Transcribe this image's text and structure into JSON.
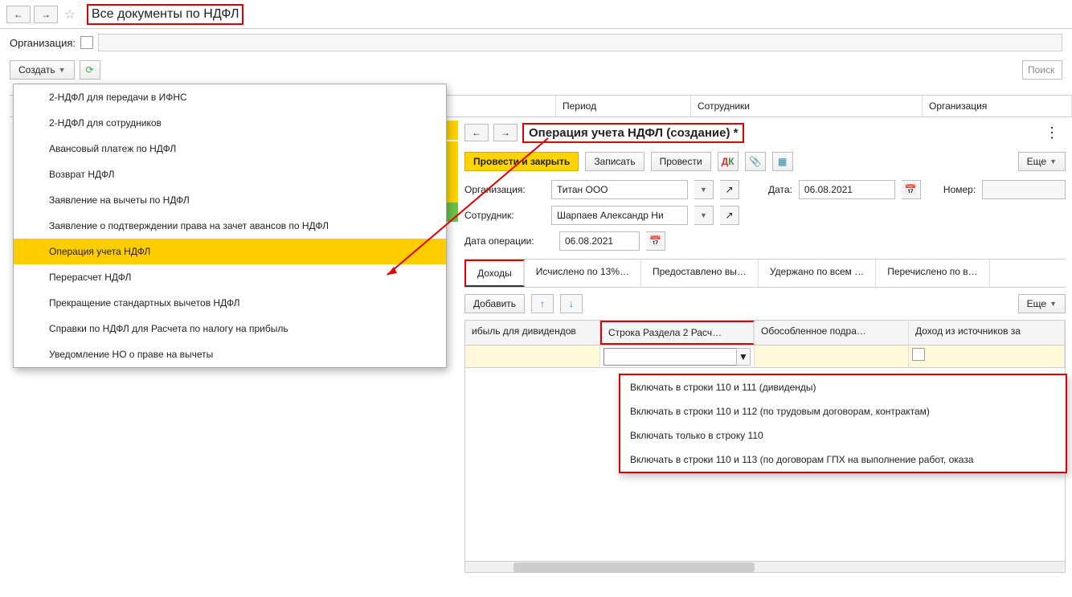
{
  "topbar": {
    "title": "Все документы по НДФЛ"
  },
  "filter": {
    "label": "Организация:"
  },
  "toolbar": {
    "create_label": "Создать",
    "search_placeholder": "Поиск"
  },
  "list_header": {
    "period": "Период",
    "employees": "Сотрудники",
    "org": "Организация"
  },
  "create_menu": {
    "items": [
      "2-НДФЛ для передачи в ИФНС",
      "2-НДФЛ для сотрудников",
      "Авансовый платеж по НДФЛ",
      "Возврат НДФЛ",
      "Заявление на вычеты по НДФЛ",
      "Заявление о подтверждении права на зачет авансов по НДФЛ",
      "Операция учета НДФЛ",
      "Перерасчет НДФЛ",
      "Прекращение стандартных вычетов НДФЛ",
      "Справки по НДФЛ для Расчета по налогу на прибыль",
      "Уведомление НО о праве на вычеты"
    ],
    "selected_index": 6
  },
  "dialog": {
    "title": "Операция учета НДФЛ (создание) *",
    "buttons": {
      "post_close": "Провести и закрыть",
      "save": "Записать",
      "post": "Провести",
      "more": "Еще"
    },
    "form": {
      "org_label": "Организация:",
      "org_value": "Титан ООО",
      "date_label": "Дата:",
      "date_value": "06.08.2021",
      "number_label": "Номер:",
      "employee_label": "Сотрудник:",
      "employee_value": "Шарпаев Александр Ни",
      "op_date_label": "Дата операции:",
      "op_date_value": "06.08.2021"
    },
    "tabs": [
      "Доходы",
      "Исчислено по 13%…",
      "Предоставлено вы…",
      "Удержано по всем …",
      "Перечислено по в…"
    ],
    "active_tab": 0,
    "sub_toolbar": {
      "add": "Добавить",
      "more": "Еще"
    },
    "grid": {
      "headers": [
        "ибыль для дивидендов",
        "Строка Раздела 2 Расч…",
        "Обособленное подра…",
        "Доход из источников за"
      ]
    },
    "section2_options": [
      "Включать в строки 110 и 111 (дивиденды)",
      "Включать в строки 110 и 112 (по трудовым договорам, контрактам)",
      "Включать только в строку 110",
      "Включать в строки 110 и 113 (по договорам ГПХ на выполнение работ, оказа"
    ]
  }
}
